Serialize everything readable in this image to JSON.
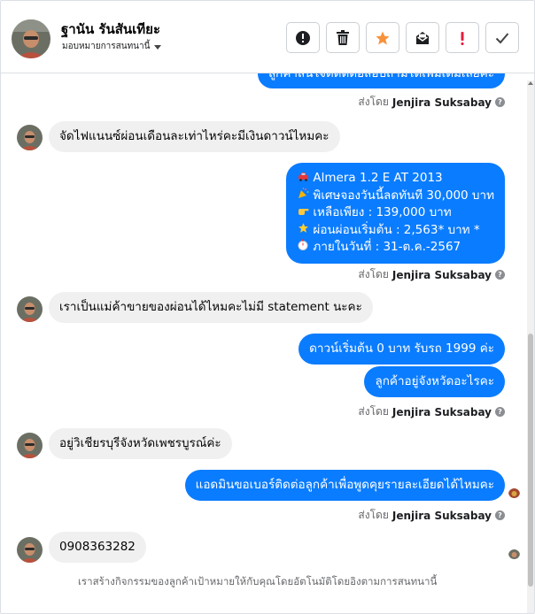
{
  "header": {
    "contact_name": "ฐานัน รันสันเทียะ",
    "assign_label": "มอบหมายการสนทนานี้",
    "actions": [
      {
        "name": "spam-button",
        "icon": "alert-circle-icon"
      },
      {
        "name": "delete-button",
        "icon": "trash-icon"
      },
      {
        "name": "star-button",
        "icon": "star-icon"
      },
      {
        "name": "mark-unread-button",
        "icon": "envelope-icon"
      },
      {
        "name": "flag-button",
        "icon": "exclamation-icon"
      },
      {
        "name": "done-button",
        "icon": "check-icon"
      }
    ]
  },
  "colors": {
    "outgoing_bubble": "#0a7cff",
    "incoming_bubble": "#f0f0f0",
    "star": "#f7923b",
    "flag": "#e41e3f"
  },
  "conversation": {
    "msg0_partial": "ลูกค้าสนใจต์ติดต่อสอบถามได้เพิ่มเติมเลยค่ะ",
    "sent_prefix": "ส่งโดย",
    "agent_name": "Jenjira Suksabay",
    "msg1": "จัดไฟแนนซ์ผ่อนเดือนละเท่าไหร่คะมีเงินดาวน์ไหมคะ",
    "promo": {
      "line1": "Almera 1.2 E AT 2013",
      "line2": "พิเศษจองวันนี้ลดทันที 30,000 บาท",
      "line3": "เหลือเพียง : 139,000 บาท",
      "line4": "ผ่อนผ่อนเริ่มต้น : 2,563* บาท *",
      "line5": "ภายในวันที่ : 31-ต.ค.-2567",
      "icons": [
        "car-icon",
        "party-popper-icon",
        "pointing-hand-icon",
        "star-icon",
        "stopwatch-icon"
      ]
    },
    "msg2": "เราเป็นแม่ค้าขายของผ่อนได้ไหมคะไม่มี statement นะคะ",
    "msg3": "ดาวน์เริ่มต้น 0 บาท รับรถ 1999 ค่ะ",
    "msg4": "ลูกค้าอยู่จังหวัดอะไรคะ",
    "msg5": "อยู่วิเชียรบุรีจังหวัดเพชรบูรณ์ค่ะ",
    "msg6": "แอดมินขอเบอร์ติดต่อลูกค้าเพื่อพูดคุยรายละเอียดได้ไหมคะ",
    "msg7": "0908363282",
    "footer_note": "เราสร้างกิจกรรมของลูกค้าเป้าหมายให้กับคุณโดยอัตโนมัติโดยอิงตามการสนทนานี้"
  }
}
